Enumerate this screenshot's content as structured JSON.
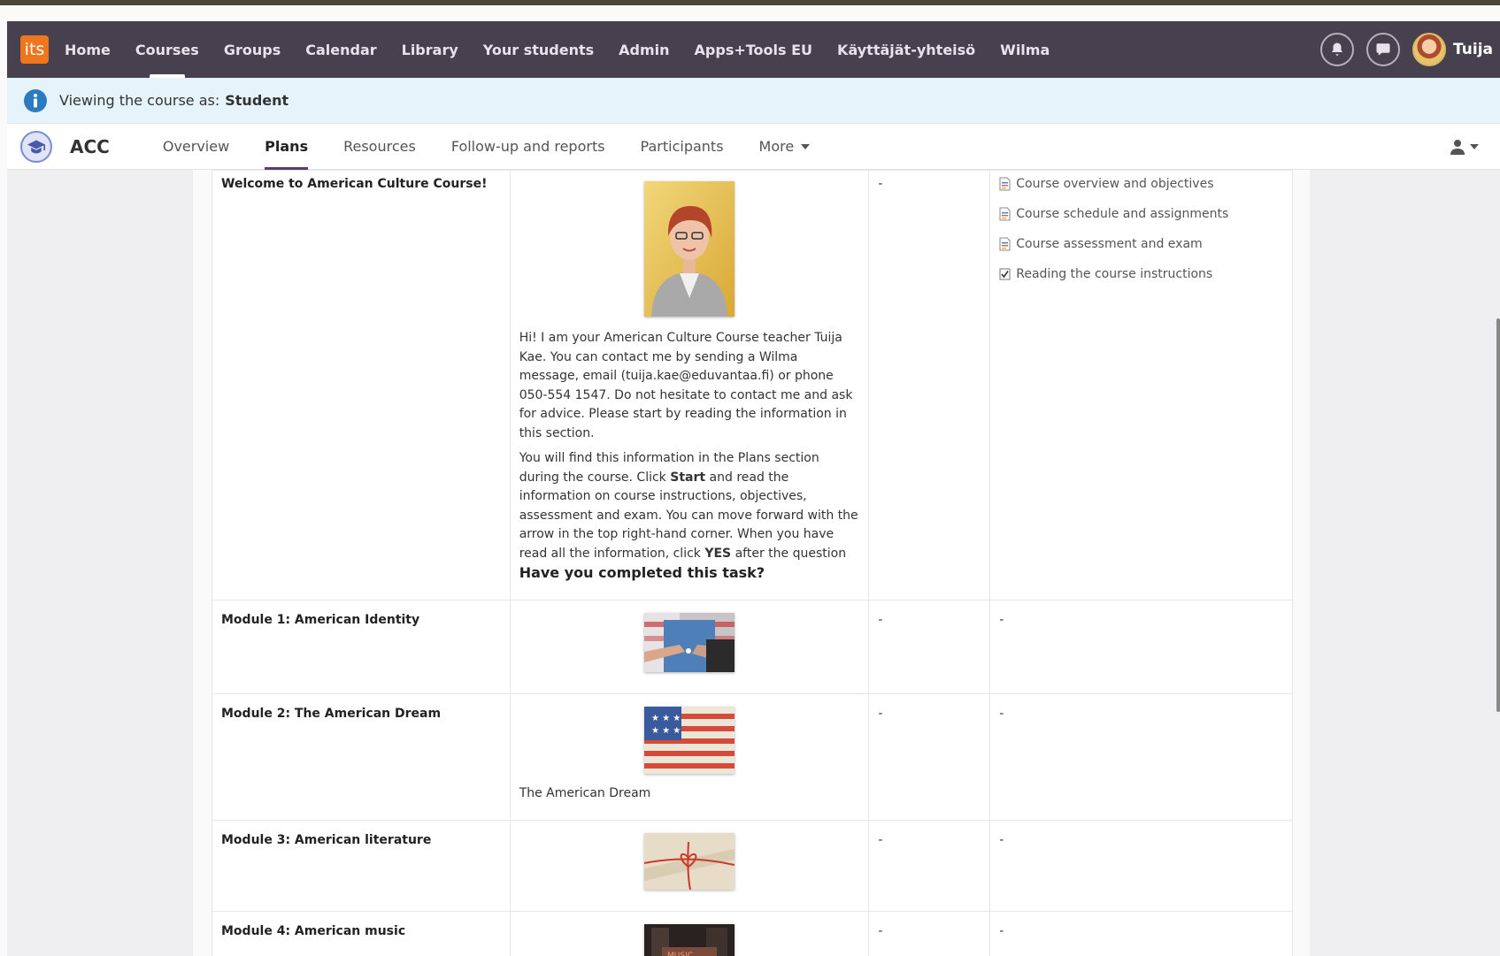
{
  "topnav": {
    "logo": "its",
    "items": [
      {
        "label": "Home"
      },
      {
        "label": "Courses"
      },
      {
        "label": "Groups"
      },
      {
        "label": "Calendar"
      },
      {
        "label": "Library"
      },
      {
        "label": "Your students"
      },
      {
        "label": "Admin"
      },
      {
        "label": "Apps+Tools EU"
      },
      {
        "label": "Käyttäjät-yhteisö"
      },
      {
        "label": "Wilma"
      }
    ],
    "active": "Courses",
    "user": "Tuija"
  },
  "infobar": {
    "text": "Viewing the course as:",
    "role": "Student"
  },
  "course": {
    "code": "ACC",
    "tabs": [
      {
        "label": "Overview"
      },
      {
        "label": "Plans"
      },
      {
        "label": "Resources"
      },
      {
        "label": "Follow-up and reports"
      },
      {
        "label": "Participants"
      },
      {
        "label": "More"
      }
    ],
    "active_tab": "Plans"
  },
  "plans": {
    "welcome": {
      "title": "Welcome to American Culture Course!",
      "paragraph1": "Hi! I am your American Culture Course teacher Tuija Kae. You can contact me by sending a Wilma message, email (tuija.kae@eduvantaa.fi) or phone 050-554 1547. Do not hesitate to contact me and ask for advice. Please start by reading the information in this section.",
      "p2_a": "You will find this information in the Plans section during the course. Click ",
      "p2_start": "Start",
      "p2_b": " and read the information on course instructions, objectives, assessment and exam. You can move forward with the arrow in the top right-hand corner. When you have read all the information, click ",
      "p2_yes": "YES",
      "p2_c": " after the question ",
      "p2_question": "Have you completed this task?",
      "col3": "-",
      "resources": [
        {
          "label": "Course overview and objectives",
          "icon": "document-icon"
        },
        {
          "label": "Course schedule and assignments",
          "icon": "document-icon"
        },
        {
          "label": "Course assessment and exam",
          "icon": "document-icon"
        },
        {
          "label": "Reading the course instructions",
          "icon": "checkbox-task-icon"
        }
      ]
    },
    "modules": [
      {
        "title": "Module 1: American Identity",
        "caption": "",
        "col3": "-",
        "col4": "-"
      },
      {
        "title": "Module 2: The American Dream",
        "caption": "The American Dream",
        "col3": "-",
        "col4": "-"
      },
      {
        "title": "Module 3: American literature",
        "caption": "",
        "col3": "-",
        "col4": "-"
      },
      {
        "title": "Module 4: American music",
        "caption": "",
        "col3": "-",
        "col4": "-"
      }
    ]
  },
  "colors": {
    "nav_bg": "#46404f",
    "info_bg": "#e6f3fb",
    "accent_orange": "#f0761e",
    "tab_underline": "#5a3b6e"
  }
}
